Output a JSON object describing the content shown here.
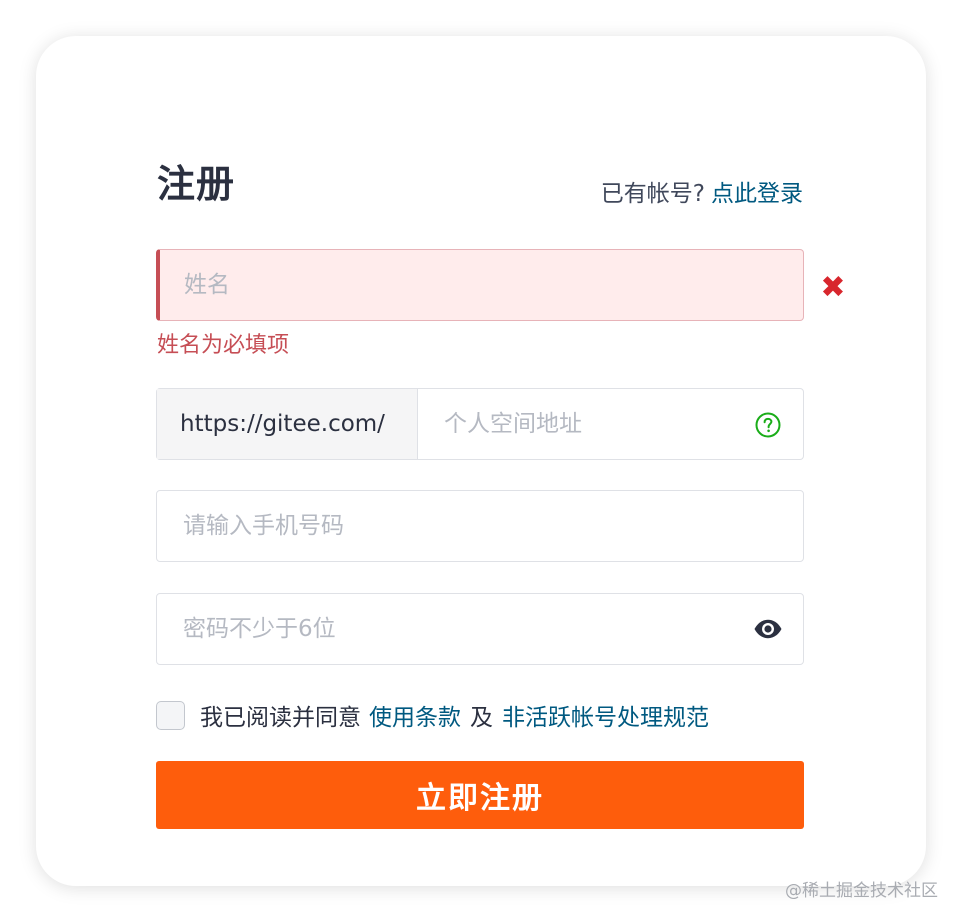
{
  "form": {
    "title": "注册",
    "login_prompt": "已有帐号?",
    "login_link": "点此登录",
    "name": {
      "placeholder": "姓名",
      "value": "",
      "error": "姓名为必填项",
      "error_icon": "close-x-icon",
      "error_color": "#d8262d"
    },
    "url": {
      "prefix": "https://gitee.com/",
      "placeholder": "个人空间地址",
      "help_icon": "question-circle-icon",
      "help_color": "#1aad19"
    },
    "phone": {
      "placeholder": "请输入手机号码",
      "value": ""
    },
    "password": {
      "placeholder": "密码不少于6位",
      "value": "",
      "toggle_icon": "eye-icon"
    },
    "agreement": {
      "text": "我已阅读并同意",
      "terms_link": "使用条款",
      "conjunction": "及",
      "policy_link": "非活跃帐号处理规范",
      "checked": false
    },
    "submit_label": "立即注册",
    "accent_color": "#fe5d0c",
    "link_color": "#005980"
  },
  "watermark": "@稀土掘金技术社区"
}
